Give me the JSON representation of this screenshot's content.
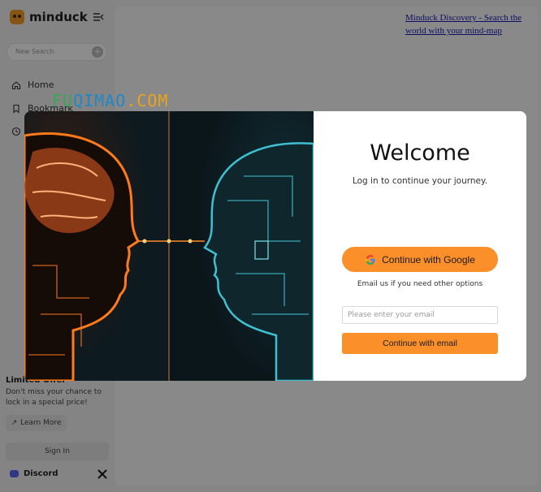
{
  "app": {
    "name": "minduck",
    "new_search_placeholder": "New Search",
    "nav": [
      {
        "label": "Home",
        "icon": "home-icon"
      },
      {
        "label": "Bookmark",
        "icon": "bookmark-icon"
      },
      {
        "label": "",
        "icon": "history-icon"
      }
    ],
    "promo": {
      "title": "Limited Offer",
      "text": "Don't miss your chance to lock in a special price!",
      "learn_more": "Learn More"
    },
    "signin_label": "Sign In",
    "discord_label": "Discord",
    "banner_alt": "Minduck Discovery - Search the world with your mind-map"
  },
  "watermark": {
    "part1": "FU",
    "part2": "QIMAO",
    "part3": ".COM"
  },
  "modal": {
    "title": "Welcome",
    "subtitle": "Log in to continue your journey.",
    "google_button": "Continue with Google",
    "email_hint": "Email us if you need other options",
    "email_placeholder": "Please enter your email",
    "email_button": "Continue with email"
  },
  "colors": {
    "accent": "#fb8f2a",
    "brain_glow": "#ff7a1a",
    "circuit_teal": "#3fc0d0"
  }
}
